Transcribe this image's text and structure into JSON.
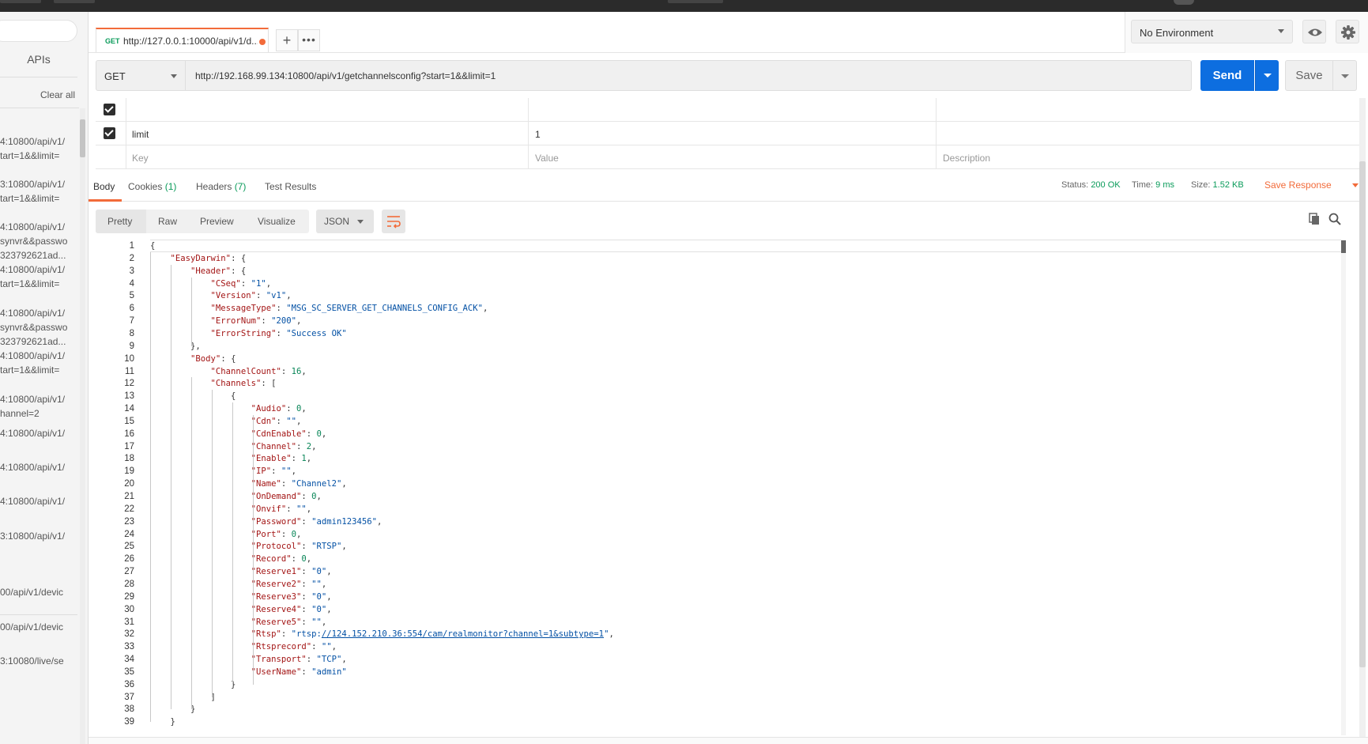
{
  "sidebar": {
    "tab_label": "APIs",
    "clear_all": "Clear all",
    "history": [
      {
        "lines": [
          "4:10800/api/v1/",
          "tart=1&&limit="
        ]
      },
      {
        "lines": [
          "3:10800/api/v1/",
          "tart=1&&limit="
        ]
      },
      {
        "lines": [
          "4:10800/api/v1/",
          "synvr&&passwo",
          "323792621ad..."
        ]
      },
      {
        "lines": [
          "4:10800/api/v1/",
          "tart=1&&limit="
        ]
      },
      {
        "lines": [
          "4:10800/api/v1/",
          "synvr&&passwo",
          "323792621ad..."
        ]
      },
      {
        "lines": [
          "4:10800/api/v1/",
          "tart=1&&limit="
        ]
      },
      {
        "lines": [
          "4:10800/api/v1/",
          "hannel=2"
        ]
      },
      {
        "lines": [
          "4:10800/api/v1/"
        ]
      },
      {
        "lines": [
          "4:10800/api/v1/"
        ]
      },
      {
        "lines": [
          "4:10800/api/v1/"
        ]
      },
      {
        "lines": [
          "3:10800/api/v1/"
        ]
      },
      {
        "lines": [
          "00/api/v1/devic"
        ]
      },
      {
        "lines": [
          "00/api/v1/devic"
        ]
      },
      {
        "lines": [
          "3:10080/live/se"
        ]
      }
    ]
  },
  "request_tab": {
    "method": "GET",
    "url": "http://127.0.0.1:10000/api/v1/d..."
  },
  "tab_actions": {
    "add": "+",
    "more": "•••"
  },
  "environment": {
    "selected": "No Environment"
  },
  "request": {
    "method": "GET",
    "url": "http://192.168.99.134:10800/api/v1/getchannelsconfig?start=1&&limit=1",
    "send_label": "Send",
    "save_label": "Save"
  },
  "params": {
    "rows": [
      {
        "key": "",
        "value": "",
        "description": "",
        "checked": true
      },
      {
        "key": "limit",
        "value": "1",
        "description": "",
        "checked": true
      }
    ],
    "placeholder": {
      "key": "Key",
      "value": "Value",
      "description": "Description"
    }
  },
  "response_tabs": {
    "body": "Body",
    "cookies": "Cookies",
    "cookies_count": "(1)",
    "headers": "Headers",
    "headers_count": "(7)",
    "tests": "Test Results"
  },
  "response_status": {
    "status_label": "Status:",
    "status_value": "200 OK",
    "time_label": "Time:",
    "time_value": "9 ms",
    "size_label": "Size:",
    "size_value": "1.52 KB",
    "save_response": "Save Response"
  },
  "view_modes": {
    "pretty": "Pretty",
    "raw": "Raw",
    "preview": "Preview",
    "visualize": "Visualize",
    "format": "JSON"
  },
  "code_lines": [
    "{",
    "    \"EasyDarwin\": {",
    "        \"Header\": {",
    "            \"CSeq\": \"1\",",
    "            \"Version\": \"v1\",",
    "            \"MessageType\": \"MSG_SC_SERVER_GET_CHANNELS_CONFIG_ACK\",",
    "            \"ErrorNum\": \"200\",",
    "            \"ErrorString\": \"Success OK\"",
    "        },",
    "        \"Body\": {",
    "            \"ChannelCount\": 16,",
    "            \"Channels\": [",
    "                {",
    "                    \"Audio\": 0,",
    "                    \"Cdn\": \"\",",
    "                    \"CdnEnable\": 0,",
    "                    \"Channel\": 2,",
    "                    \"Enable\": 1,",
    "                    \"IP\": \"\",",
    "                    \"Name\": \"Channel2\",",
    "                    \"OnDemand\": 0,",
    "                    \"Onvif\": \"\",",
    "                    \"Password\": \"admin123456\",",
    "                    \"Port\": 0,",
    "                    \"Protocol\": \"RTSP\",",
    "                    \"Record\": 0,",
    "                    \"Reserve1\": \"0\",",
    "                    \"Reserve2\": \"\",",
    "                    \"Reserve3\": \"0\",",
    "                    \"Reserve4\": \"0\",",
    "                    \"Reserve5\": \"\",",
    "                    \"Rtsp\": \"rtsp://124.152.210.36:554/cam/realmonitor?channel=1&subtype=1\",",
    "                    \"Rtsprecord\": \"\",",
    "                    \"Transport\": \"TCP\",",
    "                    \"UserName\": \"admin\"",
    "                }",
    "            ]",
    "        }",
    "    }"
  ],
  "colors": {
    "accent": "#f26b3a",
    "send": "#0d6ee0",
    "success": "#0a9b5a",
    "json_key": "#a31515",
    "json_string": "#0451a5",
    "json_number": "#098658"
  }
}
